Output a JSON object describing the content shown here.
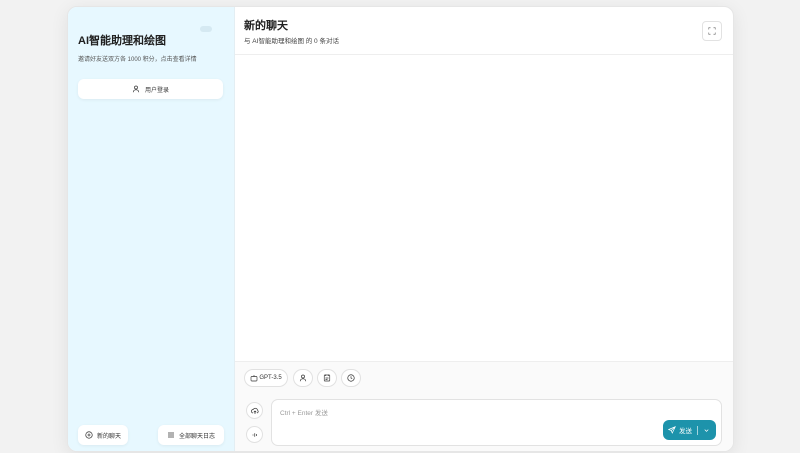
{
  "sidebar": {
    "app_title": "AI智能助理和绘图",
    "subtitle": "邀请好友送双方各 1000 积分，点击查看详情",
    "login_label": "用户登录",
    "new_chat_label": "新的聊天",
    "logout_label": "全部聊天日志"
  },
  "chat": {
    "title": "新的聊天",
    "subtitle": "与 AI智能助理和绘图 的 0 条对话"
  },
  "input": {
    "model_label": "GPT-3.5",
    "placeholder": "Ctrl + Enter 发送",
    "send_label": "发送"
  },
  "icons": {
    "login": "user-icon",
    "new_chat": "plus-circle-icon",
    "logout": "list-icon",
    "fullscreen": "maximize-icon",
    "mask": "mask-icon",
    "prompt": "prompt-icon",
    "history": "clock-icon",
    "upload": "upload-icon",
    "voice": "voice-icon",
    "send": "send-icon",
    "dropdown": "chevron-down-icon"
  },
  "colors": {
    "sidebar_bg": "#e7f8ff",
    "accent": "#1d93ab"
  }
}
